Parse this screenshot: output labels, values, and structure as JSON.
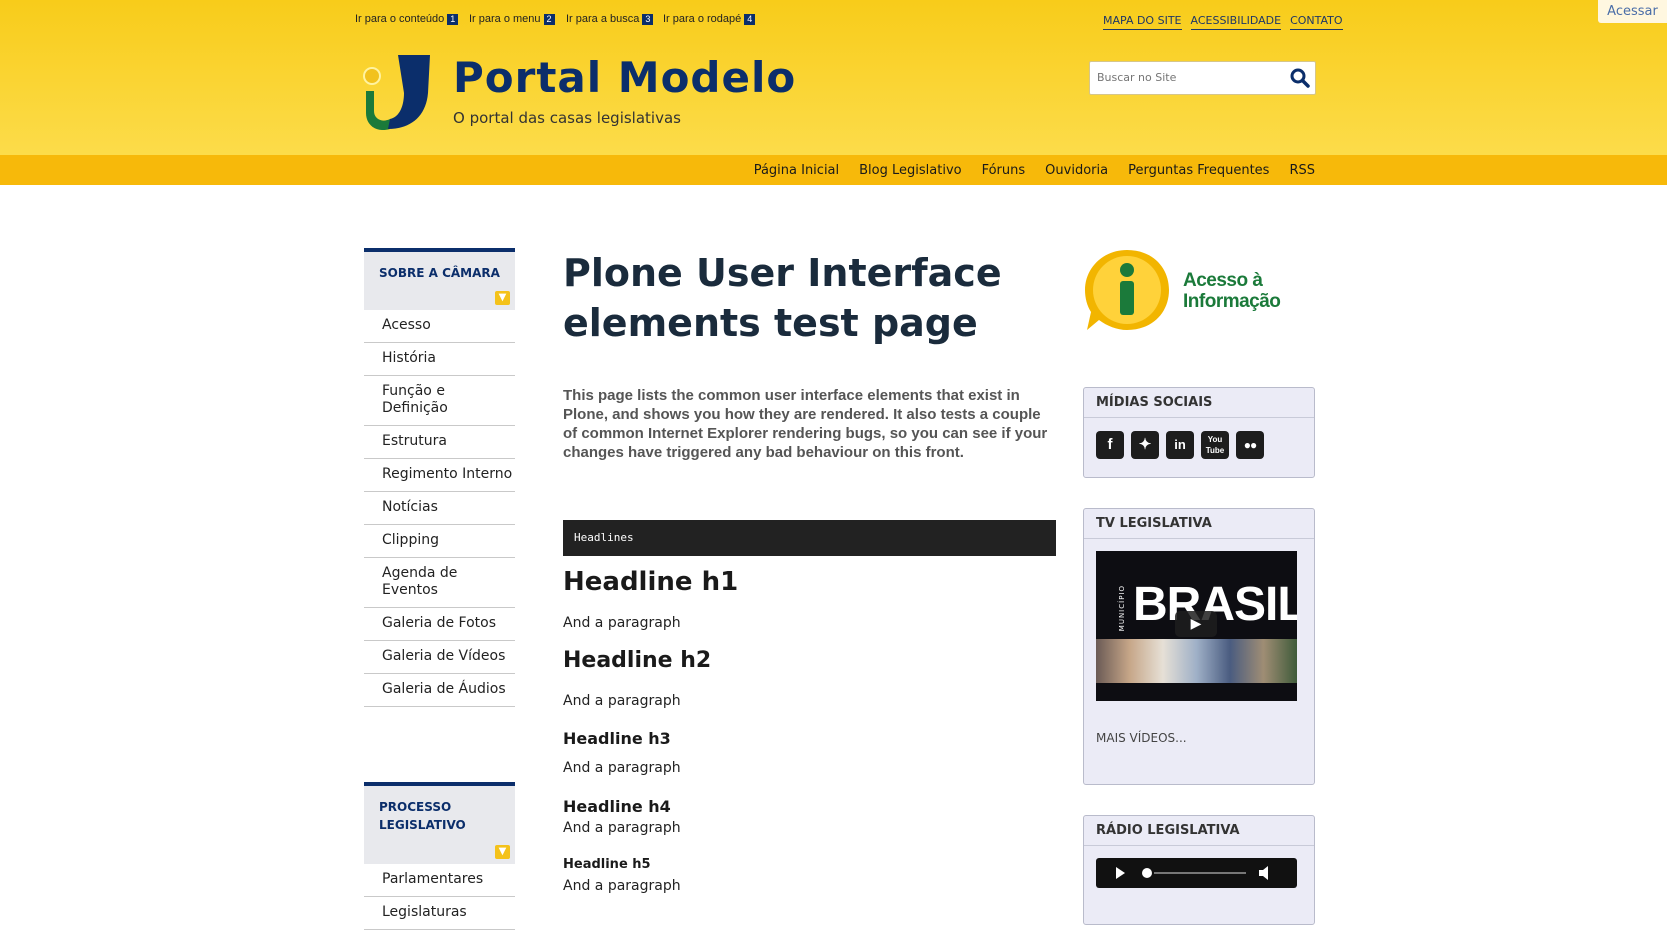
{
  "skip_links": [
    {
      "label": "Ir para o conteúdo",
      "num": "1"
    },
    {
      "label": "Ir para o menu",
      "num": "2"
    },
    {
      "label": "Ir para a busca",
      "num": "3"
    },
    {
      "label": "Ir para o rodapé",
      "num": "4"
    }
  ],
  "top_links": [
    "MAPA DO SITE",
    "ACESSIBILIDADE",
    "CONTATO"
  ],
  "login_label": "Acessar",
  "site": {
    "title": "Portal Modelo",
    "description": "O portal das casas legislativas"
  },
  "search": {
    "placeholder": "Buscar no Site"
  },
  "main_nav": [
    "Página Inicial",
    "Blog Legislativo",
    "Fóruns",
    "Ouvidoria",
    "Perguntas Frequentes",
    "RSS"
  ],
  "left": {
    "portlet1": {
      "title": "SOBRE A CÂMARA",
      "items": [
        "Acesso",
        "História",
        "Função e Definição",
        "Estrutura",
        "Regimento Interno",
        "Notícias",
        "Clipping",
        "Agenda de Eventos",
        "Galeria de Fotos",
        "Galeria de Vídeos",
        "Galeria de Áudios"
      ]
    },
    "portlet2": {
      "title": "PROCESSO LEGISLATIVO",
      "items": [
        "Parlamentares",
        "Legislaturas"
      ]
    }
  },
  "content": {
    "title": "Plone User Interface elements test page",
    "description": "This page lists the common user interface elements that exist in Plone, and shows you how they are rendered. It also tests a couple of common Internet Explorer rendering bugs, so you can see if your changes have triggered any bad behaviour on this front.",
    "code_label": "Headlines",
    "h1": "Headline h1",
    "h2": "Headline h2",
    "h3": "Headline h3",
    "h4": "Headline h4",
    "h5": "Headline h5",
    "paragraph": "And a paragraph"
  },
  "right": {
    "acesso_info": {
      "line1": "Acesso à",
      "line2": "Informação"
    },
    "midias": {
      "title": "MÍDIAS SOCIAIS",
      "icons": [
        "facebook-icon",
        "twitter-icon",
        "linkedin-icon",
        "youtube-icon",
        "flickr-icon"
      ]
    },
    "tv": {
      "title": "TV LEGISLATIVA",
      "video_small": "MUNICÍPIO",
      "video_title": "BRASIL",
      "more": "MAIS VÍDEOS..."
    },
    "radio": {
      "title": "RÁDIO LEGISLATIVA"
    }
  },
  "colors": {
    "brand_yellow": "#f8cc1a",
    "nav_yellow": "#f7b90a",
    "brand_blue": "#0b2e6b",
    "green": "#1b7a3a"
  }
}
